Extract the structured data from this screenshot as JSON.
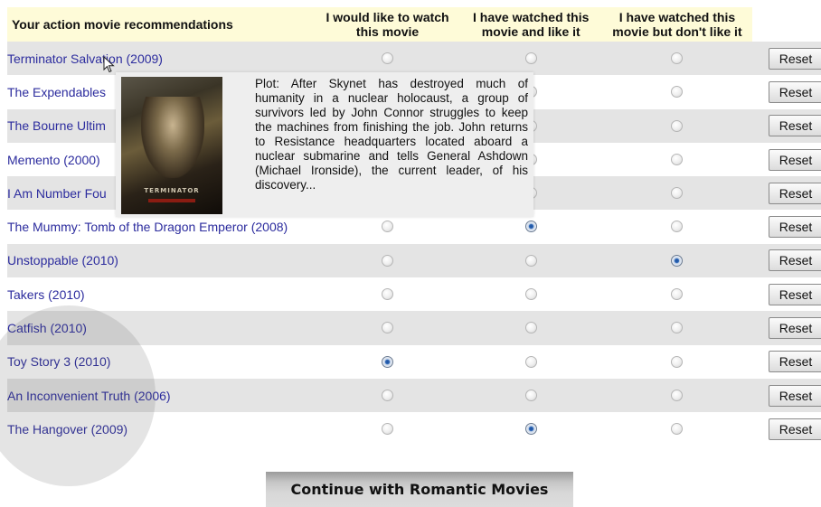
{
  "table": {
    "headers": {
      "title": "Your action movie recommendations",
      "want": "I would like to watch this movie",
      "watched_like": "I have watched this movie and like it",
      "watched_dislike": "I have watched this movie but don't like it"
    },
    "reset_label": "Reset",
    "rows": [
      {
        "title": "Terminator Salvation (2009)",
        "selected": null
      },
      {
        "title": "The Expendables",
        "selected": null
      },
      {
        "title": "The Bourne Ultim",
        "selected": null
      },
      {
        "title": "Memento (2000)",
        "selected": null
      },
      {
        "title": "I Am Number Fou",
        "selected": null
      },
      {
        "title": "The Mummy: Tomb of the Dragon Emperor (2008)",
        "selected": "watched_like"
      },
      {
        "title": "Unstoppable (2010)",
        "selected": "watched_dislike"
      },
      {
        "title": "Takers (2010)",
        "selected": null
      },
      {
        "title": "Catfish (2010)",
        "selected": null
      },
      {
        "title": "Toy Story 3 (2010)",
        "selected": "want"
      },
      {
        "title": "An Inconvenient Truth (2006)",
        "selected": null
      },
      {
        "title": "The Hangover (2009)",
        "selected": "watched_like"
      }
    ]
  },
  "popup": {
    "poster_title": "TERMINATOR",
    "plot": "Plot: After Skynet has destroyed much of humanity in a nuclear holocaust, a group of survivors led by John Connor struggles to keep the machines from finishing the job. John returns to Resistance headquarters located aboard a nuclear submarine and tells General Ashdown (Michael Ironside), the current leader, of his discovery..."
  },
  "continue_button": {
    "label": "Continue with Romantic Movies"
  },
  "colors": {
    "header_bg": "#fefbd8",
    "row_odd": "#e4e4e4",
    "row_even": "#ffffff",
    "link": "#2c2c9e"
  },
  "icons": {
    "cursor": "pointer-cursor-icon",
    "radio": "radio-button-icon"
  }
}
